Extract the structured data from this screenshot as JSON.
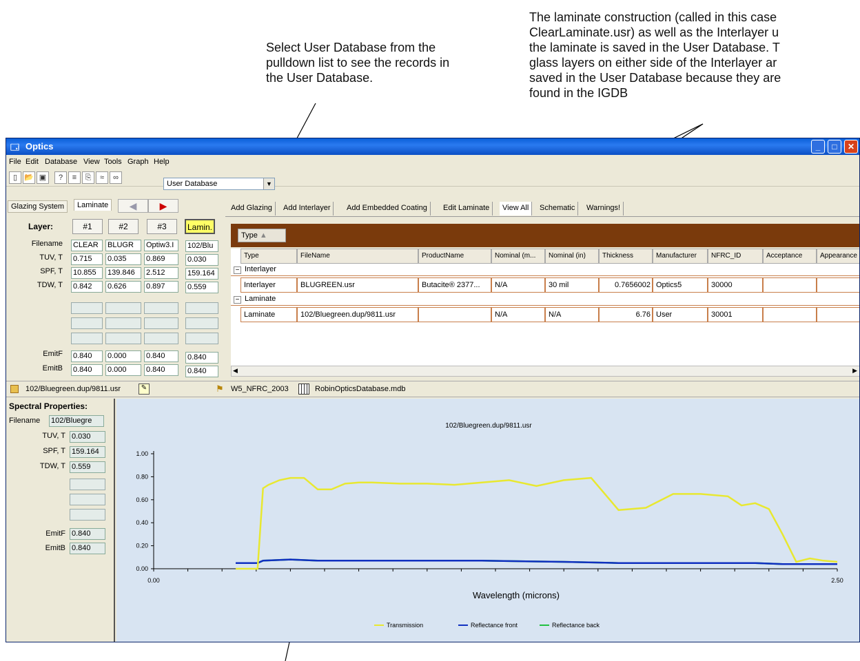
{
  "annotations": {
    "select_db": "Select User Database from the\npulldown list to see the records in\nthe User Database.",
    "laminate": "The laminate construction (called in this case\nClearLaminate.usr) as well as the Interlayer u\nthe laminate is saved in the User Database. T\nglass layers on either side of the Interlayer ar\nsaved in the User Database because they are\nfound in the IGDB"
  },
  "window": {
    "title": "Optics"
  },
  "menu": [
    "File",
    "Edit",
    "Database",
    "View",
    "Tools",
    "Graph",
    "Help"
  ],
  "toolbar": {
    "database_select": "User Database"
  },
  "left_tabs": {
    "glazing": "Glazing System",
    "laminate": "Laminate"
  },
  "layers": {
    "header_label": "Layer:",
    "columns": [
      "#1",
      "#2",
      "#3"
    ],
    "lam_button": "Lamin.",
    "rows": [
      {
        "label": "Filename",
        "values": [
          "CLEAR",
          "BLUGR",
          "Optiw3.I"
        ],
        "lam": "102/Blu"
      },
      {
        "label": "TUV, T",
        "values": [
          "0.715",
          "0.035",
          "0.869"
        ],
        "lam": "0.030"
      },
      {
        "label": "SPF, T",
        "values": [
          "10.855",
          "139.846",
          "2.512"
        ],
        "lam": "159.164"
      },
      {
        "label": "TDW, T",
        "values": [
          "0.842",
          "0.626",
          "0.897"
        ],
        "lam": "0.559"
      }
    ],
    "emit_rows": [
      {
        "label": "EmitF",
        "values": [
          "0.840",
          "0.000",
          "0.840"
        ],
        "lam": "0.840"
      },
      {
        "label": "EmitB",
        "values": [
          "0.840",
          "0.000",
          "0.840"
        ],
        "lam": "0.840"
      }
    ]
  },
  "right_tabs": [
    "Add Glazing",
    "Add Interlayer",
    "Add Embedded Coating",
    "Edit Laminate",
    "View All",
    "Schematic",
    "Warnings!"
  ],
  "grid": {
    "group_button": "Type",
    "headers": [
      "Type",
      "FileName",
      "ProductName",
      "Nominal (m...",
      "Nominal (in)",
      "Thickness",
      "Manufacturer",
      "NFRC_ID",
      "Acceptance",
      "Appearance"
    ],
    "groups": [
      {
        "name": "Interlayer",
        "row": [
          "Interlayer",
          "BLUGREEN.usr",
          "Butacite® 2377...",
          "N/A",
          "30 mil",
          "0.7656002",
          "Optics5",
          "30000",
          "",
          ""
        ]
      },
      {
        "name": "Laminate",
        "row": [
          "Laminate",
          "102/Bluegreen.dup/9811.usr",
          "",
          "N/A",
          "N/A",
          "6.76",
          "User",
          "30001",
          "",
          ""
        ]
      }
    ]
  },
  "status": {
    "file": "102/Bluegreen.dup/9811.usr",
    "db1": "W5_NFRC_2003",
    "db2": "RobinOpticsDatabase.mdb"
  },
  "spectral": {
    "title": "Spectral Properties:",
    "rows": [
      {
        "label": "Filename",
        "value": "102/Bluegre"
      },
      {
        "label": "TUV, T",
        "value": "0.030"
      },
      {
        "label": "SPF, T",
        "value": "159.164"
      },
      {
        "label": "TDW, T",
        "value": "0.559"
      }
    ],
    "emit": [
      {
        "label": "EmitF",
        "value": "0.840"
      },
      {
        "label": "EmitB",
        "value": "0.840"
      }
    ]
  },
  "chart_data": {
    "type": "line",
    "title": "102/Bluegreen.dup/9811.usr",
    "xlabel": "Wavelength (microns)",
    "ylabel": "",
    "xlim": [
      0,
      2.5
    ],
    "ylim": [
      0,
      1.0
    ],
    "x_ticks": [
      "0.00",
      "2.50"
    ],
    "y_ticks": [
      "0.00",
      "0.20",
      "0.40",
      "0.60",
      "0.80",
      "1.00"
    ],
    "series": [
      {
        "name": "Transmission",
        "color": "#e8e830",
        "x": [
          0.3,
          0.38,
          0.4,
          0.42,
          0.46,
          0.5,
          0.55,
          0.6,
          0.65,
          0.7,
          0.75,
          0.8,
          0.9,
          1.0,
          1.1,
          1.2,
          1.3,
          1.4,
          1.5,
          1.6,
          1.7,
          1.8,
          1.9,
          2.0,
          2.1,
          2.15,
          2.2,
          2.25,
          2.3,
          2.35,
          2.4,
          2.45,
          2.5
        ],
        "y": [
          0.0,
          0.0,
          0.7,
          0.73,
          0.77,
          0.79,
          0.79,
          0.69,
          0.69,
          0.74,
          0.75,
          0.75,
          0.74,
          0.74,
          0.73,
          0.75,
          0.77,
          0.72,
          0.77,
          0.79,
          0.51,
          0.53,
          0.65,
          0.65,
          0.63,
          0.55,
          0.57,
          0.52,
          0.3,
          0.06,
          0.09,
          0.07,
          0.06
        ]
      },
      {
        "name": "Reflectance front",
        "color": "#1030c0",
        "x": [
          0.3,
          0.38,
          0.4,
          0.5,
          0.6,
          0.8,
          1.0,
          1.2,
          1.5,
          1.7,
          2.0,
          2.2,
          2.3,
          2.5
        ],
        "y": [
          0.05,
          0.05,
          0.07,
          0.08,
          0.07,
          0.07,
          0.07,
          0.07,
          0.06,
          0.05,
          0.05,
          0.05,
          0.04,
          0.04
        ]
      },
      {
        "name": "Reflectance back",
        "color": "#20c040",
        "x": [
          0.3,
          0.38,
          0.4,
          0.5,
          0.6,
          0.8,
          1.0,
          1.2,
          1.5,
          1.7,
          2.0,
          2.2,
          2.3,
          2.5
        ],
        "y": [
          0.05,
          0.05,
          0.07,
          0.08,
          0.07,
          0.07,
          0.07,
          0.07,
          0.06,
          0.05,
          0.05,
          0.05,
          0.04,
          0.04
        ]
      }
    ]
  }
}
